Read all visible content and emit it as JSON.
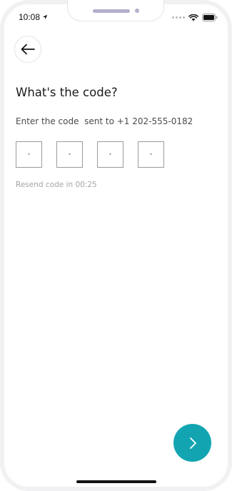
{
  "status_bar": {
    "time": "10:08",
    "location_icon": "location-arrow-icon",
    "signal_icon": "signal-dots-icon",
    "wifi_icon": "wifi-icon",
    "battery_icon": "battery-icon"
  },
  "header": {
    "back_icon": "arrow-left-icon"
  },
  "main": {
    "title": "What's the code?",
    "subtitle": "Enter the code  sent to +1 202-555-0182",
    "code_boxes": [
      {
        "placeholder": "•"
      },
      {
        "placeholder": "•"
      },
      {
        "placeholder": "•"
      },
      {
        "placeholder": "•"
      }
    ],
    "resend_text": "Resend code in 00:25"
  },
  "footer": {
    "next_icon": "chevron-right-icon"
  },
  "colors": {
    "accent": "#12a5b1",
    "title": "#1a1a1a",
    "subtitle": "#4a4a4a",
    "muted": "#a4a4a4",
    "box_border": "#9b9b9b"
  }
}
